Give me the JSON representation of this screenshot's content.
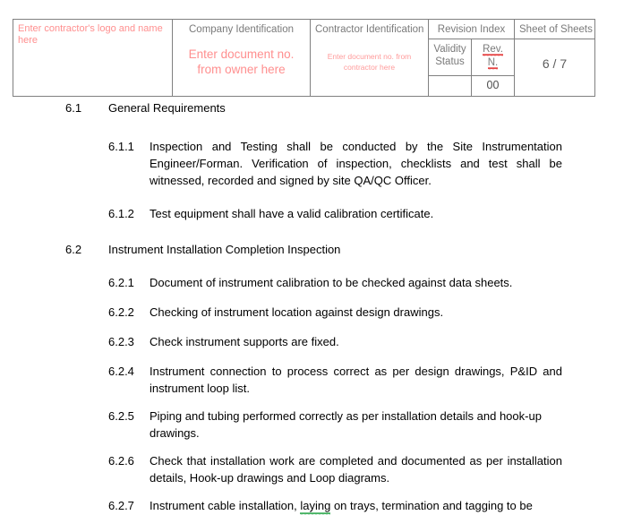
{
  "header_table": {
    "col1": {
      "placeholder": "Enter contractor's logo and name here"
    },
    "col2": {
      "label": "Company Identification",
      "placeholder": "Enter document no. from owner here"
    },
    "col3": {
      "label": "Contractor Identification",
      "placeholder": "Enter document no. from contractor here"
    },
    "col4": {
      "label": "Revision Index",
      "validity_status_line1": "Validity",
      "validity_status_line2": "Status",
      "rev_line1": "Rev.",
      "rev_line2": "N.",
      "rev_value": "00",
      "validity_value": ""
    },
    "col5": {
      "label": "Sheet  of Sheets",
      "value": "6 / 7"
    },
    "colors": {
      "border": "#808080",
      "label_text": "#7a7a7a",
      "placeholder_text": "#ff8f8f",
      "value_text": "#4d4d4d",
      "spellcheck_underline": "#e01b1b",
      "grammarcheck_underline": "#159e39"
    }
  },
  "body": {
    "sections": [
      {
        "number": "6.1",
        "title": "General Requirements",
        "items": [
          {
            "number": "6.1.1",
            "text": "Inspection and Testing shall be conducted by the Site Instrumentation Engineer/Forman. Verification of inspection, checklists and test shall be witnessed, recorded and signed by site QA/QC Officer."
          },
          {
            "number": "6.1.2",
            "text": "Test equipment shall have a valid calibration certificate."
          }
        ]
      },
      {
        "number": "6.2",
        "title": "Instrument Installation Completion Inspection",
        "items": [
          {
            "number": "6.2.1",
            "text": "Document of instrument calibration to be checked against data sheets."
          },
          {
            "number": "6.2.2",
            "text": "Checking of instrument location against design drawings."
          },
          {
            "number": "6.2.3",
            "text": "Check instrument supports are fixed."
          },
          {
            "number": "6.2.4",
            "text": "Instrument connection to process correct as per design drawings, P&ID and instrument loop list."
          },
          {
            "number": "6.2.5",
            "text": "Piping and tubing performed correctly as per installation details and hook-up drawings."
          },
          {
            "number": "6.2.6",
            "text": "Check that installation work are completed and documented as per installation details, Hook-up drawings and Loop diagrams."
          },
          {
            "number": "6.2.7",
            "text_pre": "Instrument cable installation, ",
            "text_flagged": "laying",
            "text_post": " on trays, termination and tagging to be"
          }
        ]
      }
    ]
  }
}
